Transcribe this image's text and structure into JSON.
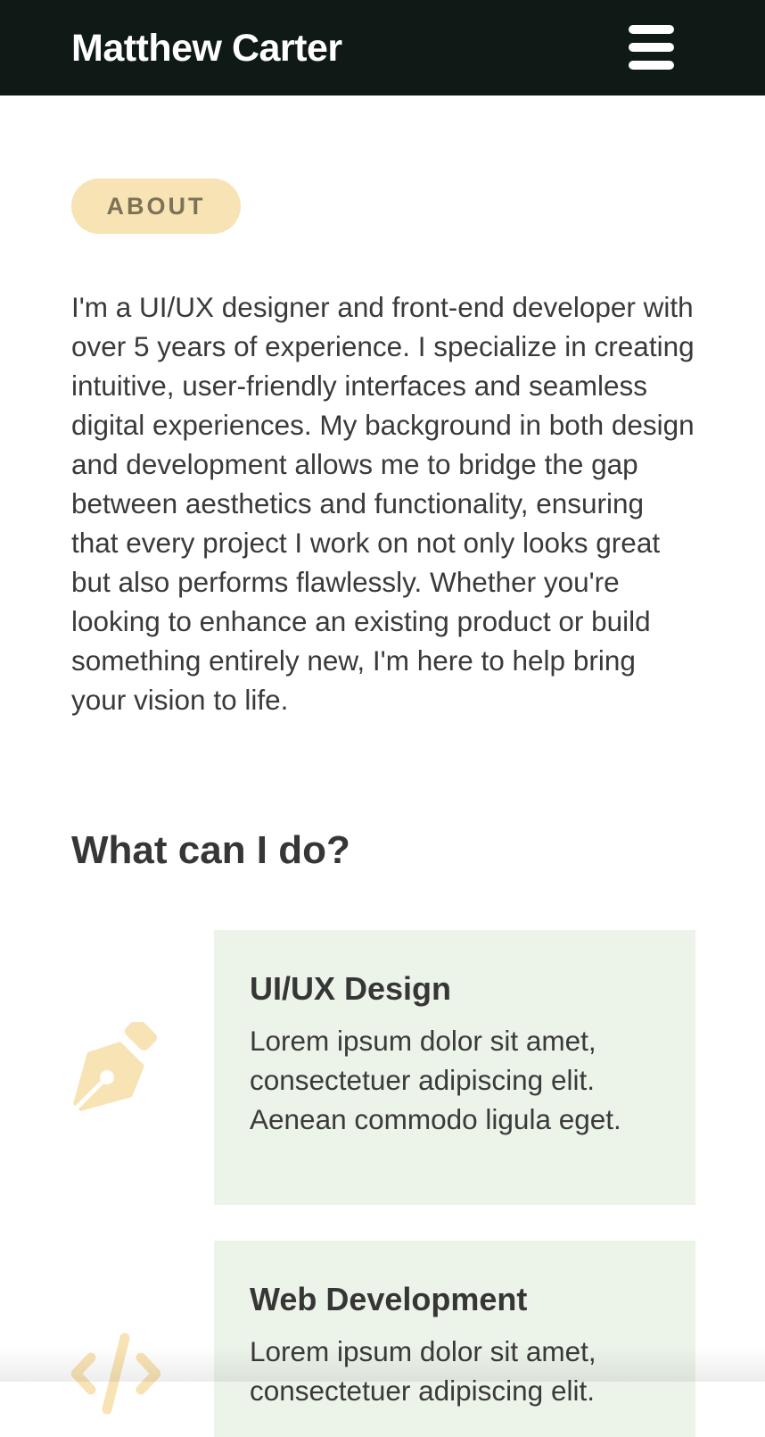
{
  "header": {
    "brand": "Matthew Carter",
    "menu_icon": "hamburger-menu-icon"
  },
  "about": {
    "badge": "ABOUT",
    "text": "I'm a UI/UX designer and front-end developer with over 5 years of experience. I specialize in creating intuitive, user-friendly interfaces and seamless digital experiences. My background in both design and development allows me to bridge the gap between aesthetics and functionality, ensuring that every project I work on not only looks great but also performs flawlessly. Whether you're looking to enhance an existing product or build something entirely new, I'm here to help bring your vision to life."
  },
  "services": {
    "title": "What can I do?",
    "items": [
      {
        "icon": "pen-nib-icon",
        "title": "UI/UX Design",
        "text": "Lorem ipsum dolor sit amet, consectetuer adipiscing elit. Aenean commodo ligula eget."
      },
      {
        "icon": "code-icon",
        "title": "Web Development",
        "text": "Lorem ipsum dolor sit amet, consectetuer adipiscing elit."
      }
    ]
  },
  "colors": {
    "header_bg": "#0f1a17",
    "accent": "#f8e3b5",
    "card_bg": "#ecf3e9",
    "text": "#3a3a3a"
  }
}
